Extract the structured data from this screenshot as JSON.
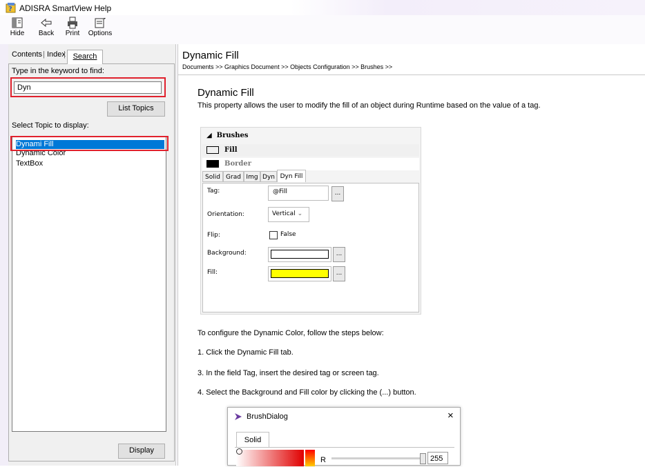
{
  "window": {
    "title": "ADISRA SmartView Help"
  },
  "toolbar": {
    "buttons": [
      {
        "label": "Hide",
        "icon": "hide-icon"
      },
      {
        "label": "Back",
        "icon": "back-arrow-icon"
      },
      {
        "label": "Print",
        "icon": "print-icon"
      },
      {
        "label": "Options",
        "icon": "options-icon"
      }
    ]
  },
  "nav": {
    "tabs": [
      "Contents",
      "Index",
      "Search"
    ],
    "search": {
      "keyword_label": "Type in the keyword to find:",
      "keyword_value": "Dyn",
      "list_topics_label": "List Topics",
      "topic_label": "Select Topic to display:",
      "topics": [
        "Dynami Fill",
        "Dynamic Color",
        "TextBox"
      ],
      "selected_index": 0,
      "display_label": "Display"
    }
  },
  "content": {
    "page_title": "Dynamic Fill",
    "breadcrumb": "Documents >> Graphics Document >> Objects Configuration >> Brushes >>",
    "heading": "Dynamic Fill",
    "description": "This property allows the user to modify the fill of an object during Runtime based on the value of a tag.",
    "figure": {
      "section": "Brushes",
      "rows": [
        {
          "label": "Fill",
          "swatch": "#ffff00"
        },
        {
          "label": "Border",
          "swatch": "#000000"
        }
      ],
      "tabs": [
        "Solid",
        "Grad",
        "Img",
        "Dyn",
        "Dyn Fill"
      ],
      "fields": {
        "tag_label": "Tag:",
        "tag_value": "@Fill",
        "orientation_label": "Orientation:",
        "orientation_value": "Vertical",
        "flip_label": "Flip:",
        "flip_value": "False",
        "background_label": "Background:",
        "background_color": "#ffffff",
        "fill_label": "Fill:",
        "fill_color": "#ffff00",
        "ellipsis": "..."
      }
    },
    "intro": "To configure the Dynamic Color, follow the steps below:",
    "steps": [
      "1.  Click the Dynamic Fill tab.",
      "3.  In the field Tag, insert the desired tag or screen tag.",
      "4.  Select the Background and Fill color by clicking the (...) button."
    ],
    "dialog": {
      "title": "BrushDialog",
      "close": "×",
      "tab": "Solid",
      "channel": "R",
      "value": "255"
    }
  },
  "colors": {
    "selection": "#0078d7",
    "highlight_box": "#e0202c"
  }
}
